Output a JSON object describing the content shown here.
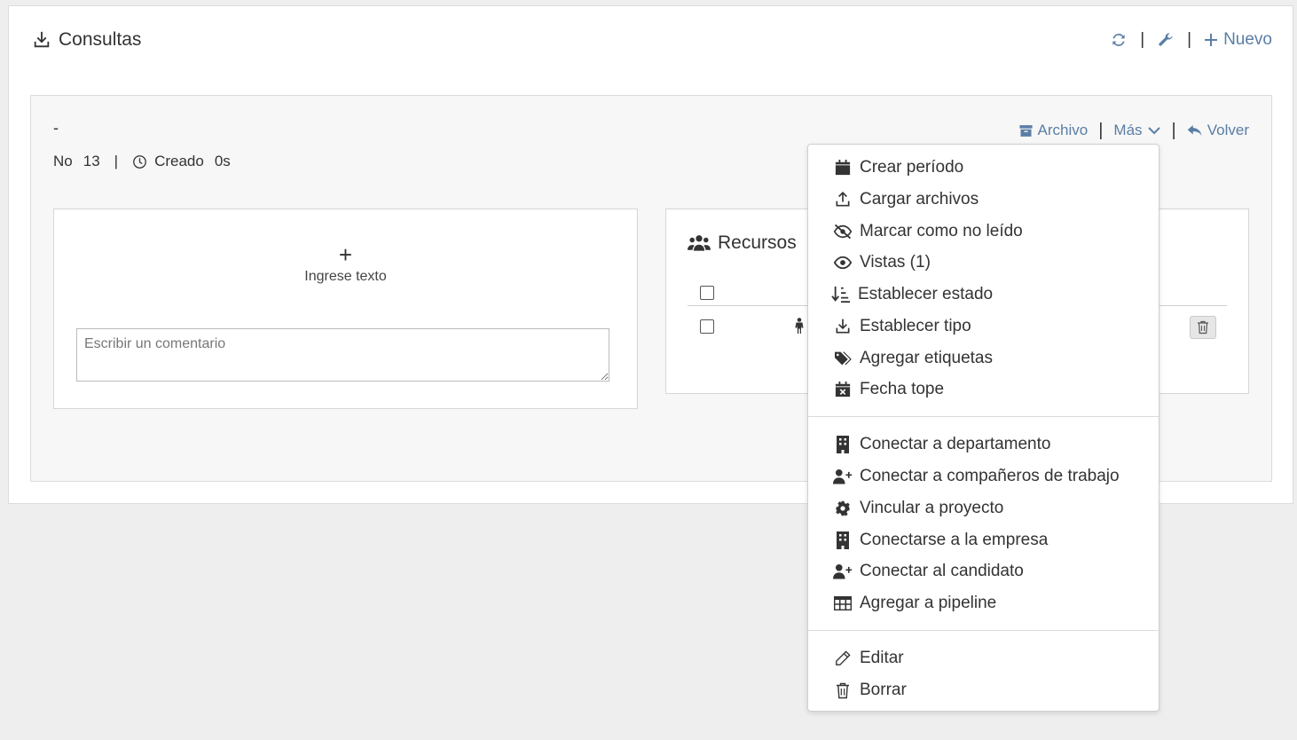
{
  "header": {
    "title": "Consultas",
    "nuevo_label": "Nuevo",
    "separator": "|"
  },
  "record": {
    "dash": "-",
    "no_label": "No",
    "no_value": "13",
    "created_label": "Creado",
    "created_value": "0s",
    "separator": "|"
  },
  "actions": {
    "archivo_label": "Archivo",
    "mas_label": "Más",
    "volver_label": "Volver"
  },
  "comment_card": {
    "plus": "+",
    "title": "Ingrese texto",
    "placeholder": "Escribir un comentario"
  },
  "resources_card": {
    "title": "Recursos"
  },
  "dropdown": {
    "items": [
      {
        "label": "Crear período",
        "icon": "calendar-icon"
      },
      {
        "label": "Cargar archivos",
        "icon": "upload-icon"
      },
      {
        "label": "Marcar como no leído",
        "icon": "eye-slash-icon"
      },
      {
        "label": "Vistas (1)",
        "icon": "eye-icon"
      },
      {
        "label": "Establecer estado",
        "icon": "sort-icon"
      },
      {
        "label": "Establecer tipo",
        "icon": "download-icon"
      },
      {
        "label": "Agregar etiquetas",
        "icon": "tags-icon"
      },
      {
        "label": "Fecha tope",
        "icon": "calendar-x-icon"
      },
      {
        "label": "Conectar a departamento",
        "icon": "building-icon"
      },
      {
        "label": "Conectar a compañeros de trabajo",
        "icon": "user-plus-icon"
      },
      {
        "label": "Vincular a proyecto",
        "icon": "gear-icon"
      },
      {
        "label": "Conectarse a la empresa",
        "icon": "building-icon"
      },
      {
        "label": "Conectar al candidato",
        "icon": "user-plus-icon"
      },
      {
        "label": "Agregar a pipeline",
        "icon": "table-icon"
      },
      {
        "label": "Editar",
        "icon": "pencil-icon"
      },
      {
        "label": "Borrar",
        "icon": "trash-icon"
      }
    ]
  },
  "colors": {
    "accent": "#5a7ea6",
    "background": "#eeeeee",
    "text": "#333333"
  }
}
